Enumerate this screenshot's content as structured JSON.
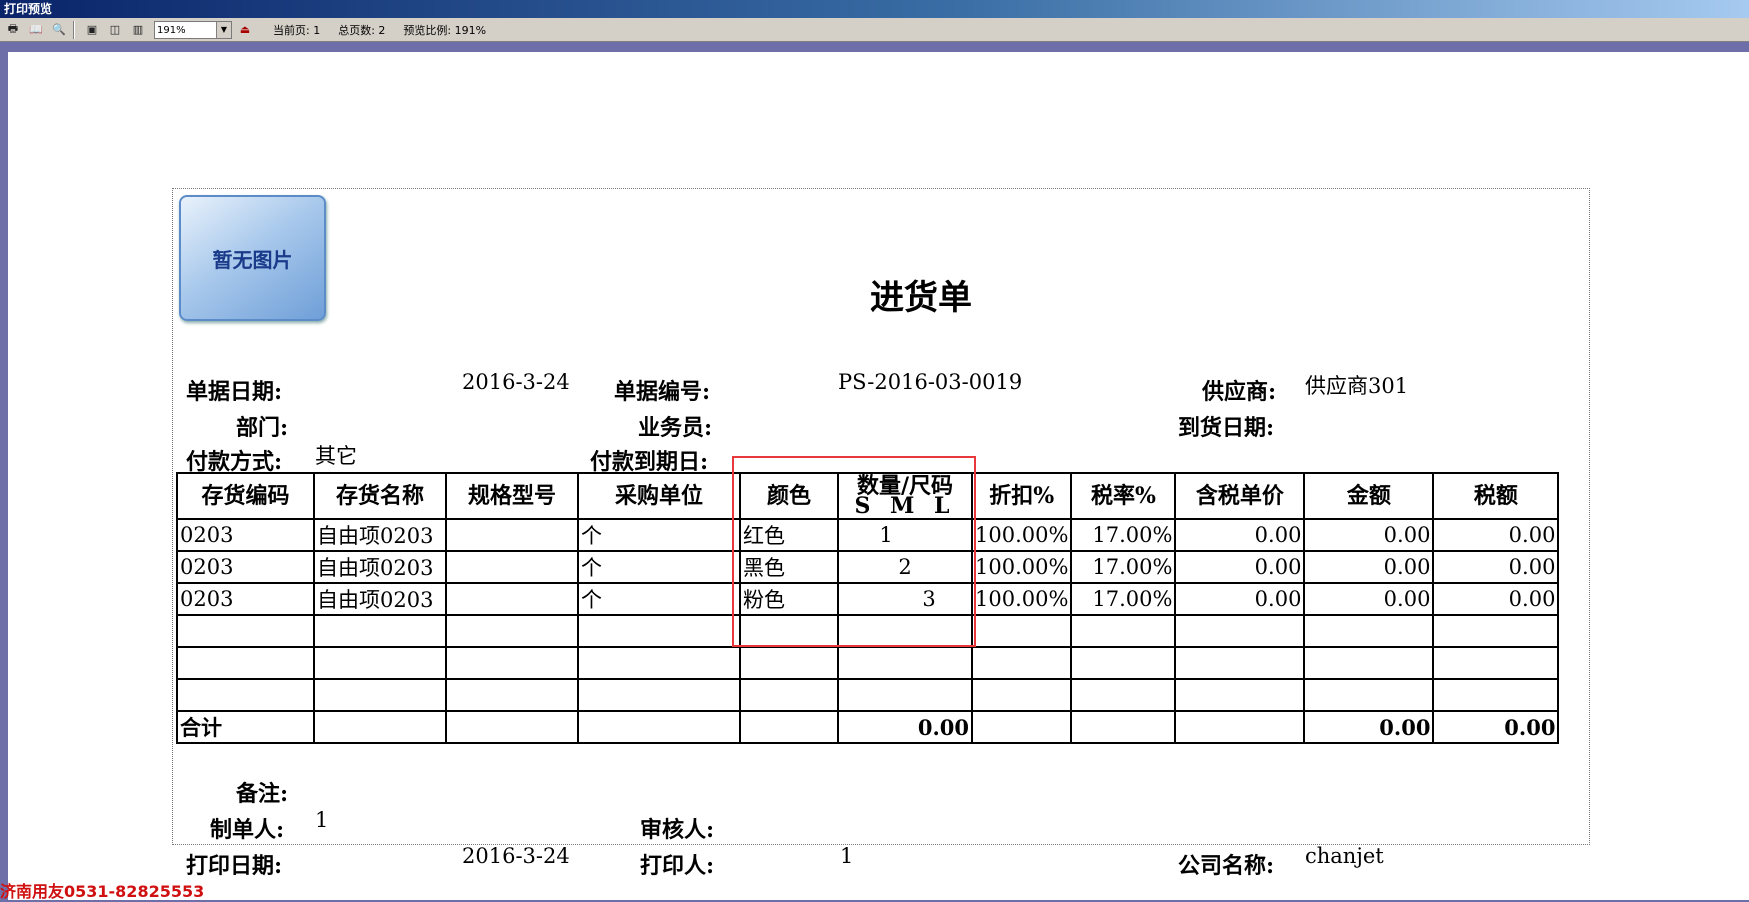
{
  "window": {
    "title": "打印预览"
  },
  "toolbar": {
    "zoom_value": "191%",
    "current_page": "当前页: 1",
    "total_pages": "总页数: 2",
    "preview_ratio": "预览比例: 191%",
    "icons": [
      "print-icon",
      "book-icon",
      "zoom-icon",
      "one-page-icon",
      "two-page-icon",
      "multi-page-icon",
      "exit-icon"
    ]
  },
  "doc": {
    "logo_text": "暂无图片",
    "title": "进货单",
    "fields": {
      "date_label": "单据日期:",
      "date_value": "2016-3-24",
      "number_label": "单据编号:",
      "number_value": "PS-2016-03-0019",
      "supplier_label": "供应商:",
      "supplier_value": "供应商301",
      "dept_label": "部门:",
      "salesman_label": "业务员:",
      "arrival_label": "到货日期:",
      "payment_label": "付款方式:",
      "payment_value": "其它",
      "due_label": "付款到期日:"
    },
    "table": {
      "headers": [
        "存货编码",
        "存货名称",
        "规格型号",
        "采购单位",
        "颜色",
        "数量/尺码",
        "折扣%",
        "税率%",
        "含税单价",
        "金额",
        "税额"
      ],
      "size_sub": "S M L",
      "rows": [
        {
          "code": "0203",
          "name": "自由项0203",
          "spec": "",
          "unit": "个",
          "color": "红色",
          "qty": "1",
          "discount": "100.00%",
          "tax_rate": "17.00%",
          "price": "0.00",
          "amount": "0.00",
          "tax": "0.00"
        },
        {
          "code": "0203",
          "name": "自由项0203",
          "spec": "",
          "unit": "个",
          "color": "黑色",
          "qty": "2",
          "discount": "100.00%",
          "tax_rate": "17.00%",
          "price": "0.00",
          "amount": "0.00",
          "tax": "0.00"
        },
        {
          "code": "0203",
          "name": "自由项0203",
          "spec": "",
          "unit": "个",
          "color": "粉色",
          "qty": "3",
          "discount": "100.00%",
          "tax_rate": "17.00%",
          "price": "0.00",
          "amount": "0.00",
          "tax": "0.00"
        }
      ],
      "total_label": "合计",
      "total_qty": "0.00",
      "total_amount": "0.00",
      "total_tax": "0.00"
    },
    "footer": {
      "remark_label": "备注:",
      "maker_label": "制单人:",
      "maker_value": "1",
      "auditor_label": "审核人:",
      "print_date_label": "打印日期:",
      "print_date_value": "2016-3-24",
      "printer_label": "打印人:",
      "printer_value": "1",
      "company_label": "公司名称:",
      "company_value": "chanjet"
    }
  },
  "watermark": "济南用友0531-82825553",
  "colors": {
    "highlight_box": "#e8383b",
    "title_bar": "#0a246a"
  }
}
